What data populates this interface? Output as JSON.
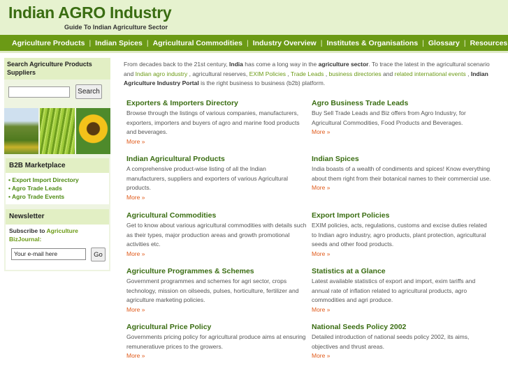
{
  "site": {
    "title": "Indian AGRO Industry",
    "subtitle": "Guide To Indian Agriculture Sector"
  },
  "nav": {
    "items": [
      "Agriculture Products",
      "Indian Spices",
      "Agricultural Commodities",
      "Industry Overview",
      "Institutes & Organisations",
      "Glossary",
      "Resources"
    ],
    "separator": "|"
  },
  "sidebar": {
    "search": {
      "heading": "Search Agriculture Products Suppliers",
      "input_value": "",
      "button_label": "Search"
    },
    "b2b": {
      "heading": "B2B Marketplace",
      "links": [
        "Export Import Directory",
        "Agro Trade Leads",
        "Agro Trade Events"
      ]
    },
    "newsletter": {
      "heading": "Newsletter",
      "text_prefix": "Subscribe to",
      "text_green": "Agriculture",
      "text_suffix": "BizJournal:",
      "email_placeholder": "Your e-mail here",
      "button_label": "Go"
    }
  },
  "intro": {
    "t1": "From decades back to the 21st century,",
    "b1": "India",
    "t2": "has come a long way in the",
    "b2": "agriculture sector",
    "t3": ". To trace the latest in the agricultural scenario and",
    "l1": "Indian agro industry",
    "t4": ", agricultural reserves,",
    "l2": "EXIM Policies",
    "t5": ",",
    "l3": "Trade Leads",
    "t6": ",",
    "l4": "business directories",
    "t7": "and",
    "l5": "related international events",
    "t8": ",",
    "b3": "Indian Agriculture Industry Portal",
    "t9": "is the right business to business (b2b) platform."
  },
  "cards": [
    {
      "title": "Exporters & Importers Directory",
      "desc": "Browse through the listings of various companies, manufacturers, exporters, importers and buyers of agro and marine food products and beverages.",
      "more": "More »"
    },
    {
      "title": "Agro Business Trade Leads",
      "desc": "Buy Sell Trade Leads and Biz offers from Agro Industry, for Agricultural Commodities, Food Products and Beverages.",
      "more": "More »"
    },
    {
      "title": "Indian Agricultural Products",
      "desc": "A comprehensive product-wise listing of all the Indian manufacturers, suppliers and exporters of various Agricultural products.",
      "more": "More »"
    },
    {
      "title": "Indian Spices",
      "desc": "India boasts of a wealth of condiments and spices! Know everything about them right from their botanical names to their commercial use.",
      "more": "More »"
    },
    {
      "title": "Agricultural Commodities",
      "desc": "Get to know about various agricultural commodities with details such as their types, major production areas and growth promotional activities etc.",
      "more": "More »"
    },
    {
      "title": "Export Import Policies",
      "desc": "EXIM policies, acts, regulations, customs and excise duties related to Indian agro industry, agro products, plant protection, agricultural seeds and other food products.",
      "more": "More »"
    },
    {
      "title": "Agriculture Programmes & Schemes",
      "desc": "Government programmes and schemes for agri sector, crops technology, mission on oilseeds, pulses, horticulture, fertilizer and agriculture marketing policies.",
      "more": "More »"
    },
    {
      "title": "Statistics at a Glance",
      "desc": "Latest available statistics of export and import, exim tariffs and annual rate of inflation related to agricultural products, agro commodities and agri produce.",
      "more": "More »"
    },
    {
      "title": "Agricultural Price Policy",
      "desc": "Governments pricing policy for agricultural produce aims at ensuring remuneratiuve prices to the growers.",
      "more": "More »"
    },
    {
      "title": "National Seeds Policy 2002",
      "desc": "Detailed introduction of national seeds policy 2002, its aims, objectives and thrust areas.",
      "more": "More »"
    }
  ],
  "colors": {
    "brand_green": "#3a6d12",
    "nav_bg": "#6b9a15",
    "header_bg": "#e6f2cf",
    "more_link": "#e05a1a"
  }
}
